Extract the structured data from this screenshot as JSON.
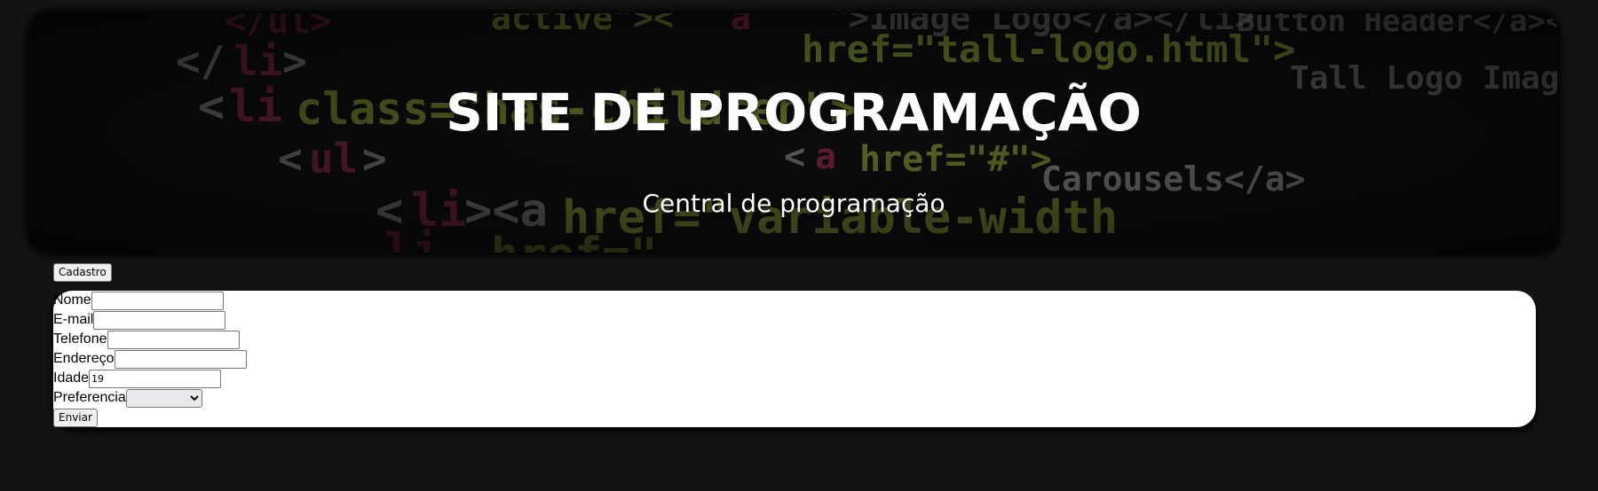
{
  "header": {
    "title": "SITE DE PROGRAMAÇÃO",
    "subtitle": "Central de programação"
  },
  "nav": {
    "cadastro_label": "Cadastro"
  },
  "form": {
    "fields": [
      {
        "label": "Nome",
        "value": ""
      },
      {
        "label": "E-mail",
        "value": ""
      },
      {
        "label": "Telefone",
        "value": ""
      },
      {
        "label": "Endereço",
        "value": ""
      },
      {
        "label": "Idade",
        "value": "19"
      }
    ],
    "preferencia": {
      "label": "Preferencia",
      "selected": ""
    },
    "submit_label": "Enviar"
  },
  "colors": {
    "page_background": "#131313",
    "panel_background": "#ffffff",
    "code_green": "#b8d94a",
    "code_red": "#e0245e",
    "code_white": "#d9d9d9"
  },
  "icons": {
    "select_arrow": "chevron-down-icon"
  }
}
